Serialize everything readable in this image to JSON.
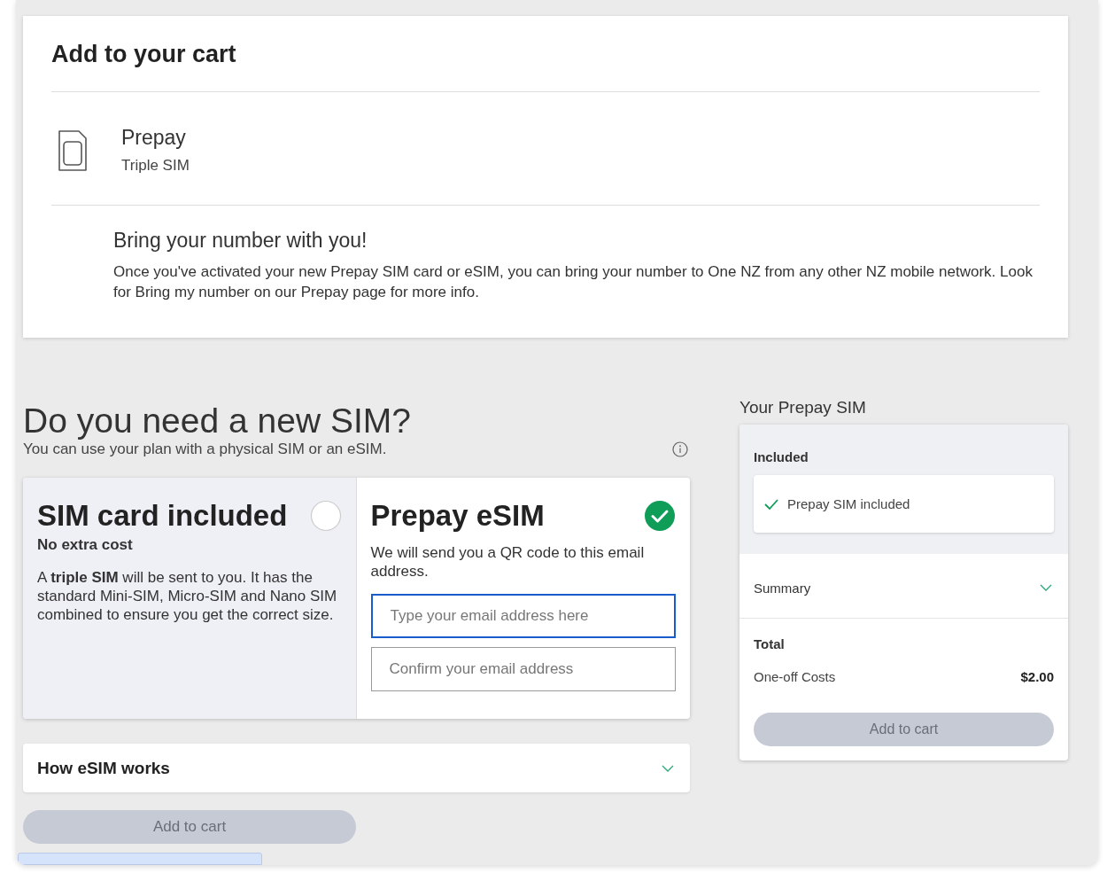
{
  "cart": {
    "title": "Add to your cart",
    "product": {
      "name": "Prepay",
      "variant": "Triple SIM"
    },
    "notice": {
      "title": "Bring your number with you!",
      "text": "Once you've activated your new Prepay SIM card or eSIM, you can bring your number to One NZ from any other NZ mobile network. Look for Bring my number on our Prepay page for more info."
    }
  },
  "sim_section": {
    "title": "Do you need a new SIM?",
    "subtitle": "You can use your plan with a physical SIM or an eSIM.",
    "options": [
      {
        "title": "SIM card included",
        "subtitle": "No extra cost",
        "description": "A **triple SIM** will be sent to you. It has the standard Mini-SIM, Micro-SIM and Nano SIM combined to ensure you get the correct size.",
        "selected": false
      },
      {
        "title": "Prepay eSIM",
        "description": "We will send you a QR code to this email address.",
        "selected": true,
        "fields": [
          {
            "placeholder": "Type your email address here",
            "focused": true
          },
          {
            "placeholder": "Confirm your email address",
            "focused": false
          }
        ]
      }
    ],
    "accordion": {
      "label": "How eSIM works",
      "expanded": false
    },
    "button": {
      "label": "Add to cart",
      "disabled": true
    }
  },
  "summary": {
    "title": "Your Prepay SIM",
    "included": {
      "label": "Included",
      "items": [
        "Prepay SIM included"
      ]
    },
    "summary_row": {
      "label": "Summary",
      "expanded": false
    },
    "total_label": "Total",
    "costs": [
      {
        "label": "One-off Costs",
        "value": "$2.00"
      }
    ],
    "button": {
      "label": "Add to cart",
      "disabled": true
    }
  }
}
